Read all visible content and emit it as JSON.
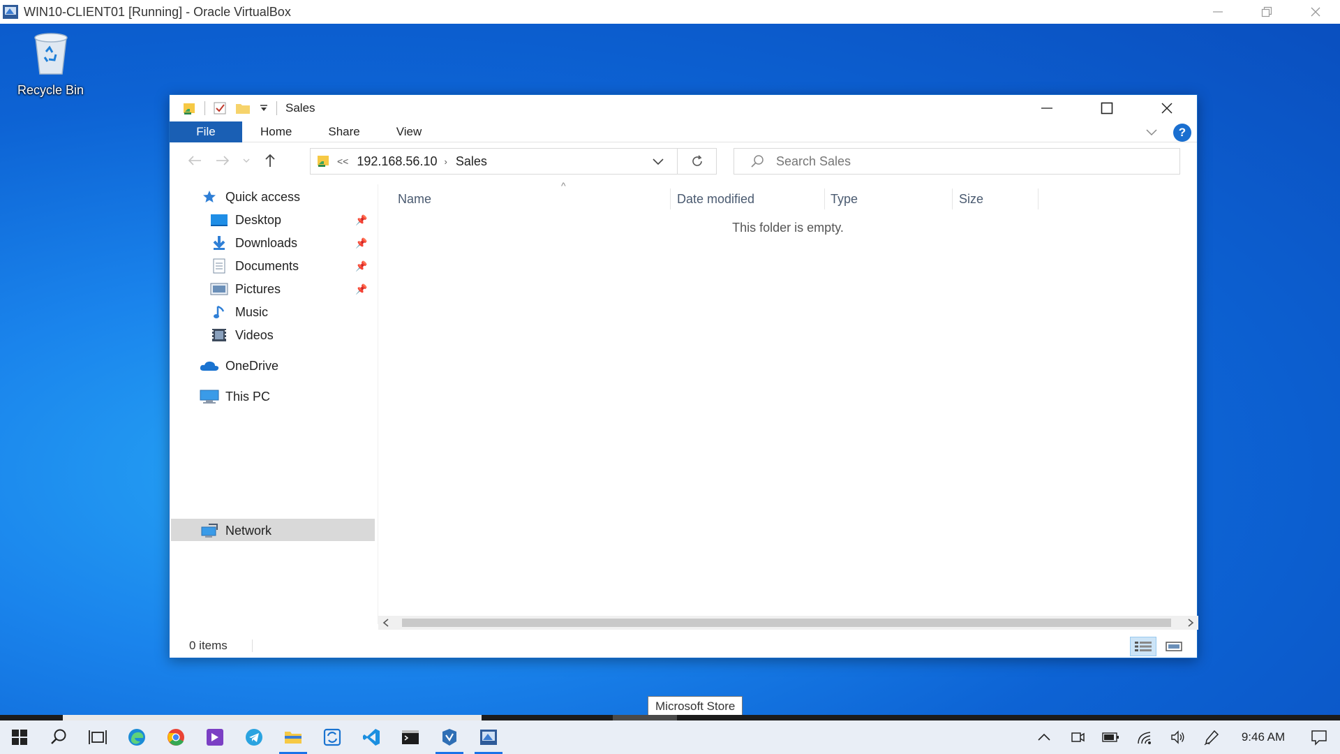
{
  "vbox": {
    "title": "WIN10-CLIENT01 [Running] - Oracle VirtualBox",
    "controls": [
      "minimize",
      "restore",
      "close"
    ]
  },
  "desktop": {
    "icons": [
      {
        "label": "Recycle Bin",
        "icon": "recycle-bin-icon"
      }
    ]
  },
  "explorer": {
    "title": "Sales",
    "ribbon": {
      "tabs": [
        "File",
        "Home",
        "Share",
        "View"
      ]
    },
    "address": {
      "overflow": "<<",
      "segments": [
        "192.168.56.10",
        "Sales"
      ]
    },
    "search": {
      "placeholder": "Search Sales"
    },
    "nav": {
      "quick_access": "Quick access",
      "pinned": [
        "Desktop",
        "Downloads",
        "Documents",
        "Pictures"
      ],
      "unpinned": [
        "Music",
        "Videos"
      ],
      "onedrive": "OneDrive",
      "this_pc": "This PC",
      "network": "Network"
    },
    "columns": [
      "Name",
      "Date modified",
      "Type",
      "Size"
    ],
    "empty_message": "This folder is empty.",
    "status": "0 items"
  },
  "tooltip": "Microsoft Store",
  "taskbar": {
    "apps": [
      "start",
      "search",
      "task-view",
      "edge",
      "chrome",
      "visual-studio",
      "telegram",
      "file-explorer",
      "sync-app",
      "vscode",
      "terminal",
      "virtualbox-manager",
      "virtualbox-vm"
    ],
    "clock": "9:46 AM"
  },
  "colors": {
    "accent": "#1a5fb4",
    "desktop": "#1a84ec",
    "nav_selected": "#d9d9d9"
  }
}
